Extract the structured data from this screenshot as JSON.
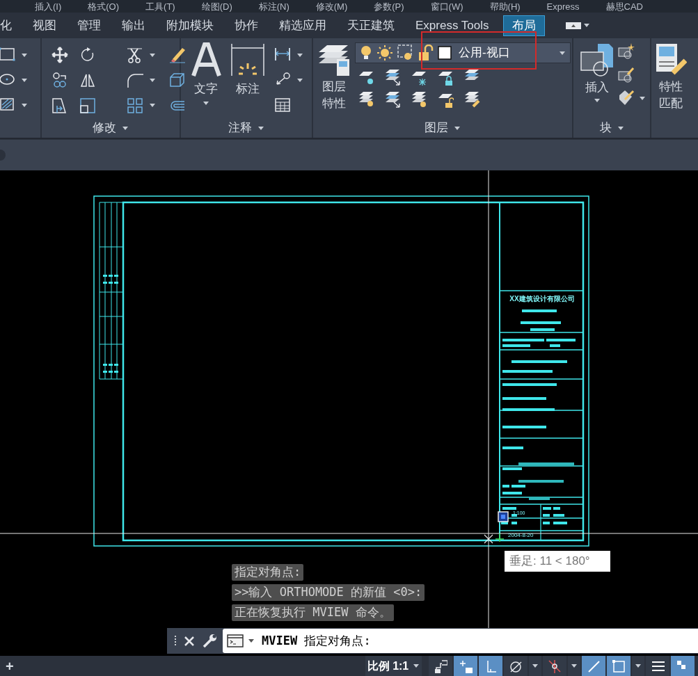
{
  "menu_bar": [
    "插入(I)",
    "格式(O)",
    "工具(T)",
    "绘图(D)",
    "标注(N)",
    "修改(M)",
    "参数(P)",
    "窗口(W)",
    "帮助(H)",
    "Express",
    "赫思CAD"
  ],
  "ribbon_tabs": [
    {
      "label": "化",
      "selected": false
    },
    {
      "label": "视图",
      "selected": false
    },
    {
      "label": "管理",
      "selected": false
    },
    {
      "label": "输出",
      "selected": false
    },
    {
      "label": "附加模块",
      "selected": false
    },
    {
      "label": "协作",
      "selected": false
    },
    {
      "label": "精选应用",
      "selected": false
    },
    {
      "label": "天正建筑",
      "selected": false
    },
    {
      "label": "Express Tools",
      "selected": false
    },
    {
      "label": "布局",
      "selected": true
    }
  ],
  "ribbon": {
    "modify_panel": {
      "title": "修改"
    },
    "annotation_panel": {
      "title": "注释",
      "buttons": [
        "文字",
        "标注"
      ]
    },
    "layers_panel": {
      "title": "图层",
      "button": "图层特性",
      "layer_dropdown": "公用-视口"
    },
    "block_panel": {
      "title": "块",
      "button": "插入"
    },
    "match_properties": "特性匹配"
  },
  "drawing": {
    "title_block_texts": [
      "XX建筑设计有限公司",
      "1:100",
      "2004-8-20"
    ]
  },
  "tooltip": "垂足: 11 < 180°",
  "command_history": [
    "指定对角点:",
    ">>输入 ORTHOMODE 的新值 <0>:",
    "正在恢复执行 MVIEW 命令。"
  ],
  "command_line": {
    "value": "**MVIEW** 指定对角点:"
  },
  "status_bar": {
    "add_tab": "+",
    "scale": "比例 1:1",
    "toggles": [
      {
        "on": false
      },
      {
        "on": true
      },
      {
        "on": true
      },
      {
        "on": false
      },
      {
        "on": false
      },
      {
        "on": true
      },
      {
        "on": true
      },
      {
        "on": false
      },
      {
        "on": true
      }
    ]
  }
}
